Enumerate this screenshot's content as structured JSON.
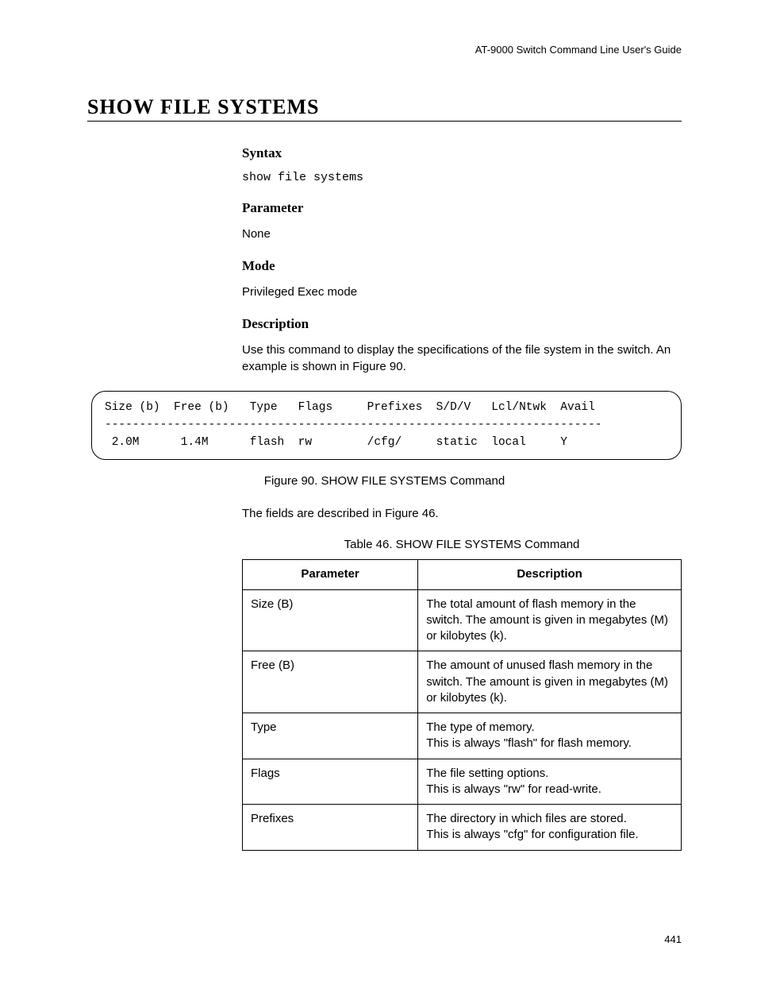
{
  "header": "AT-9000 Switch Command Line User's Guide",
  "title": "SHOW FILE SYSTEMS",
  "sections": {
    "syntax": {
      "heading": "Syntax",
      "content": "show file systems"
    },
    "parameter": {
      "heading": "Parameter",
      "content": "None"
    },
    "mode": {
      "heading": "Mode",
      "content": "Privileged Exec mode"
    },
    "description": {
      "heading": "Description",
      "content": "Use this command to display the specifications of the file system in the switch. An example is shown in Figure 90."
    }
  },
  "output_box": "Size (b)  Free (b)   Type   Flags     Prefixes  S/D/V   Lcl/Ntwk  Avail\n------------------------------------------------------------------------\n 2.0M      1.4M      flash  rw        /cfg/     static  local     Y",
  "figure_caption": "Figure 90. SHOW FILE SYSTEMS Command",
  "fields_text": "The fields are described in Figure 46.",
  "table_caption": "Table 46. SHOW FILE SYSTEMS Command",
  "table": {
    "headers": [
      "Parameter",
      "Description"
    ],
    "rows": [
      {
        "param": "Size (B)",
        "desc": "The total amount of flash memory in the switch. The amount is given in megabytes (M) or kilobytes (k)."
      },
      {
        "param": "Free (B)",
        "desc": "The amount of unused flash memory in the switch. The amount is given in megabytes (M) or kilobytes (k)."
      },
      {
        "param": "Type",
        "desc": "The type of memory.\nThis is always \"flash\" for flash memory."
      },
      {
        "param": "Flags",
        "desc": "The file setting options.\nThis is always \"rw\" for read-write."
      },
      {
        "param": "Prefixes",
        "desc": "The directory in which files are stored.\nThis is always \"cfg\" for configuration file."
      }
    ]
  },
  "page_number": "441"
}
